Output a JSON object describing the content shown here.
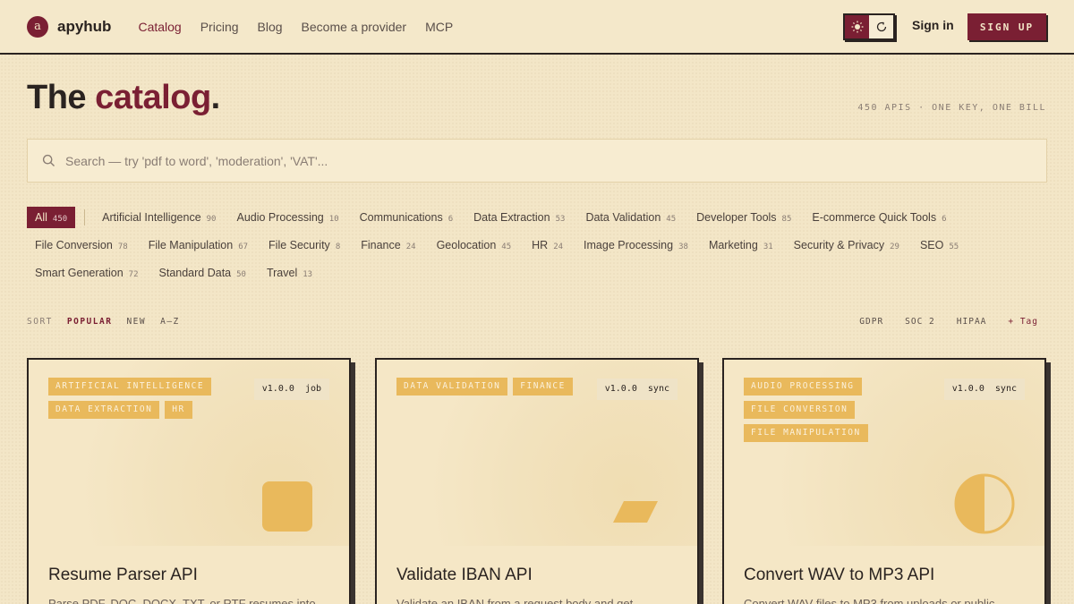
{
  "header": {
    "logo_letter": "a",
    "brand": "apyhub",
    "nav": [
      "Catalog",
      "Pricing",
      "Blog",
      "Become a provider",
      "MCP"
    ],
    "signin": "Sign in",
    "signup": "SIGN UP"
  },
  "hero": {
    "title_main": "The ",
    "title_accent": "catalog",
    "title_end": ".",
    "stats": "450 APIS · ONE KEY, ONE BILL"
  },
  "search": {
    "placeholder": "Search — try 'pdf to word', 'moderation', 'VAT'..."
  },
  "categories": {
    "all": {
      "label": "All",
      "count": "450"
    },
    "row1": [
      {
        "label": "Artificial Intelligence",
        "count": "90"
      },
      {
        "label": "Audio Processing",
        "count": "10"
      },
      {
        "label": "Communications",
        "count": "6"
      },
      {
        "label": "Data Extraction",
        "count": "53"
      },
      {
        "label": "Data Validation",
        "count": "45"
      },
      {
        "label": "Developer Tools",
        "count": "85"
      },
      {
        "label": "E-commerce Quick Tools",
        "count": "6"
      }
    ],
    "row2": [
      {
        "label": "File Conversion",
        "count": "78"
      },
      {
        "label": "File Manipulation",
        "count": "67"
      },
      {
        "label": "File Security",
        "count": "8"
      },
      {
        "label": "Finance",
        "count": "24"
      },
      {
        "label": "Geolocation",
        "count": "45"
      },
      {
        "label": "HR",
        "count": "24"
      },
      {
        "label": "Image Processing",
        "count": "38"
      },
      {
        "label": "Marketing",
        "count": "31"
      },
      {
        "label": "Security & Privacy",
        "count": "29"
      },
      {
        "label": "SEO",
        "count": "55"
      }
    ],
    "row3": [
      {
        "label": "Smart Generation",
        "count": "72"
      },
      {
        "label": "Standard Data",
        "count": "50"
      },
      {
        "label": "Travel",
        "count": "13"
      }
    ]
  },
  "sort": {
    "label": "SORT",
    "popular": "POPULAR",
    "new": "NEW",
    "az": "A–Z"
  },
  "filters": {
    "gdpr": "GDPR",
    "soc2": "SOC 2",
    "hipaa": "HIPAA",
    "add_tag": "+ Tag"
  },
  "cards": [
    {
      "tags": [
        "ARTIFICIAL INTELLIGENCE",
        "DATA EXTRACTION",
        "HR"
      ],
      "version": "v1.0.0",
      "mode": "job",
      "title": "Resume Parser API",
      "desc": "Parse PDF, DOC, DOCX, TXT, or RTF resumes into"
    },
    {
      "tags": [
        "DATA VALIDATION",
        "FINANCE"
      ],
      "version": "v1.0.0",
      "mode": "sync",
      "title": "Validate IBAN API",
      "desc": "Validate an IBAN from a request body and get"
    },
    {
      "tags": [
        "AUDIO PROCESSING",
        "FILE CONVERSION",
        "FILE MANIPULATION"
      ],
      "version": "v1.0.0",
      "mode": "sync",
      "title": "Convert WAV to MP3 API",
      "desc": "Convert WAV files to MP3 from uploads or public"
    }
  ],
  "colors": {
    "brand": "#7a1f33",
    "tag": "#e9b95c",
    "background": "#f3e6c7"
  },
  "icons": [
    "sun-icon",
    "auto-theme-icon",
    "search-icon"
  ]
}
